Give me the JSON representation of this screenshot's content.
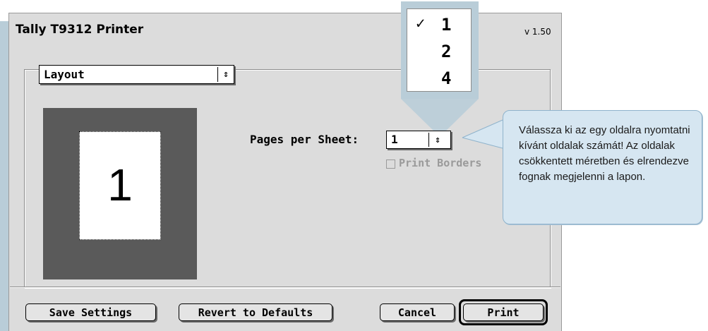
{
  "dialog": {
    "printer_name": "Tally T9312 Printer",
    "version": "v 1.50",
    "panel_popup": {
      "value": "Layout",
      "arrow_icon": "up-down-arrows-icon"
    }
  },
  "layout": {
    "preview_page_number": "1",
    "pages_per_sheet_label": "Pages per Sheet:",
    "pages_per_sheet_value": "1",
    "print_borders_label": "Print Borders",
    "print_borders_checked": false,
    "print_borders_enabled": false
  },
  "dropdown_menu": {
    "items": [
      {
        "label": "1",
        "checked": true,
        "check_icon": "checkmark-icon"
      },
      {
        "label": "2",
        "checked": false
      },
      {
        "label": "4",
        "checked": false
      }
    ]
  },
  "buttons": {
    "save": "Save Settings",
    "revert": "Revert to Defaults",
    "cancel": "Cancel",
    "print": "Print"
  },
  "callout": {
    "text": "Válassza ki az egy oldalra nyomtatni kívánt oldalak számát! Az oldalak csökkentett méretben és elrendezve fognak megjelenni a lapon."
  },
  "colors": {
    "dialog_bg": "#dcdcdc",
    "accent_blue": "#b9cdd8",
    "callout_bg": "#d6e6f1",
    "preview_dark": "#5a5a5a"
  }
}
